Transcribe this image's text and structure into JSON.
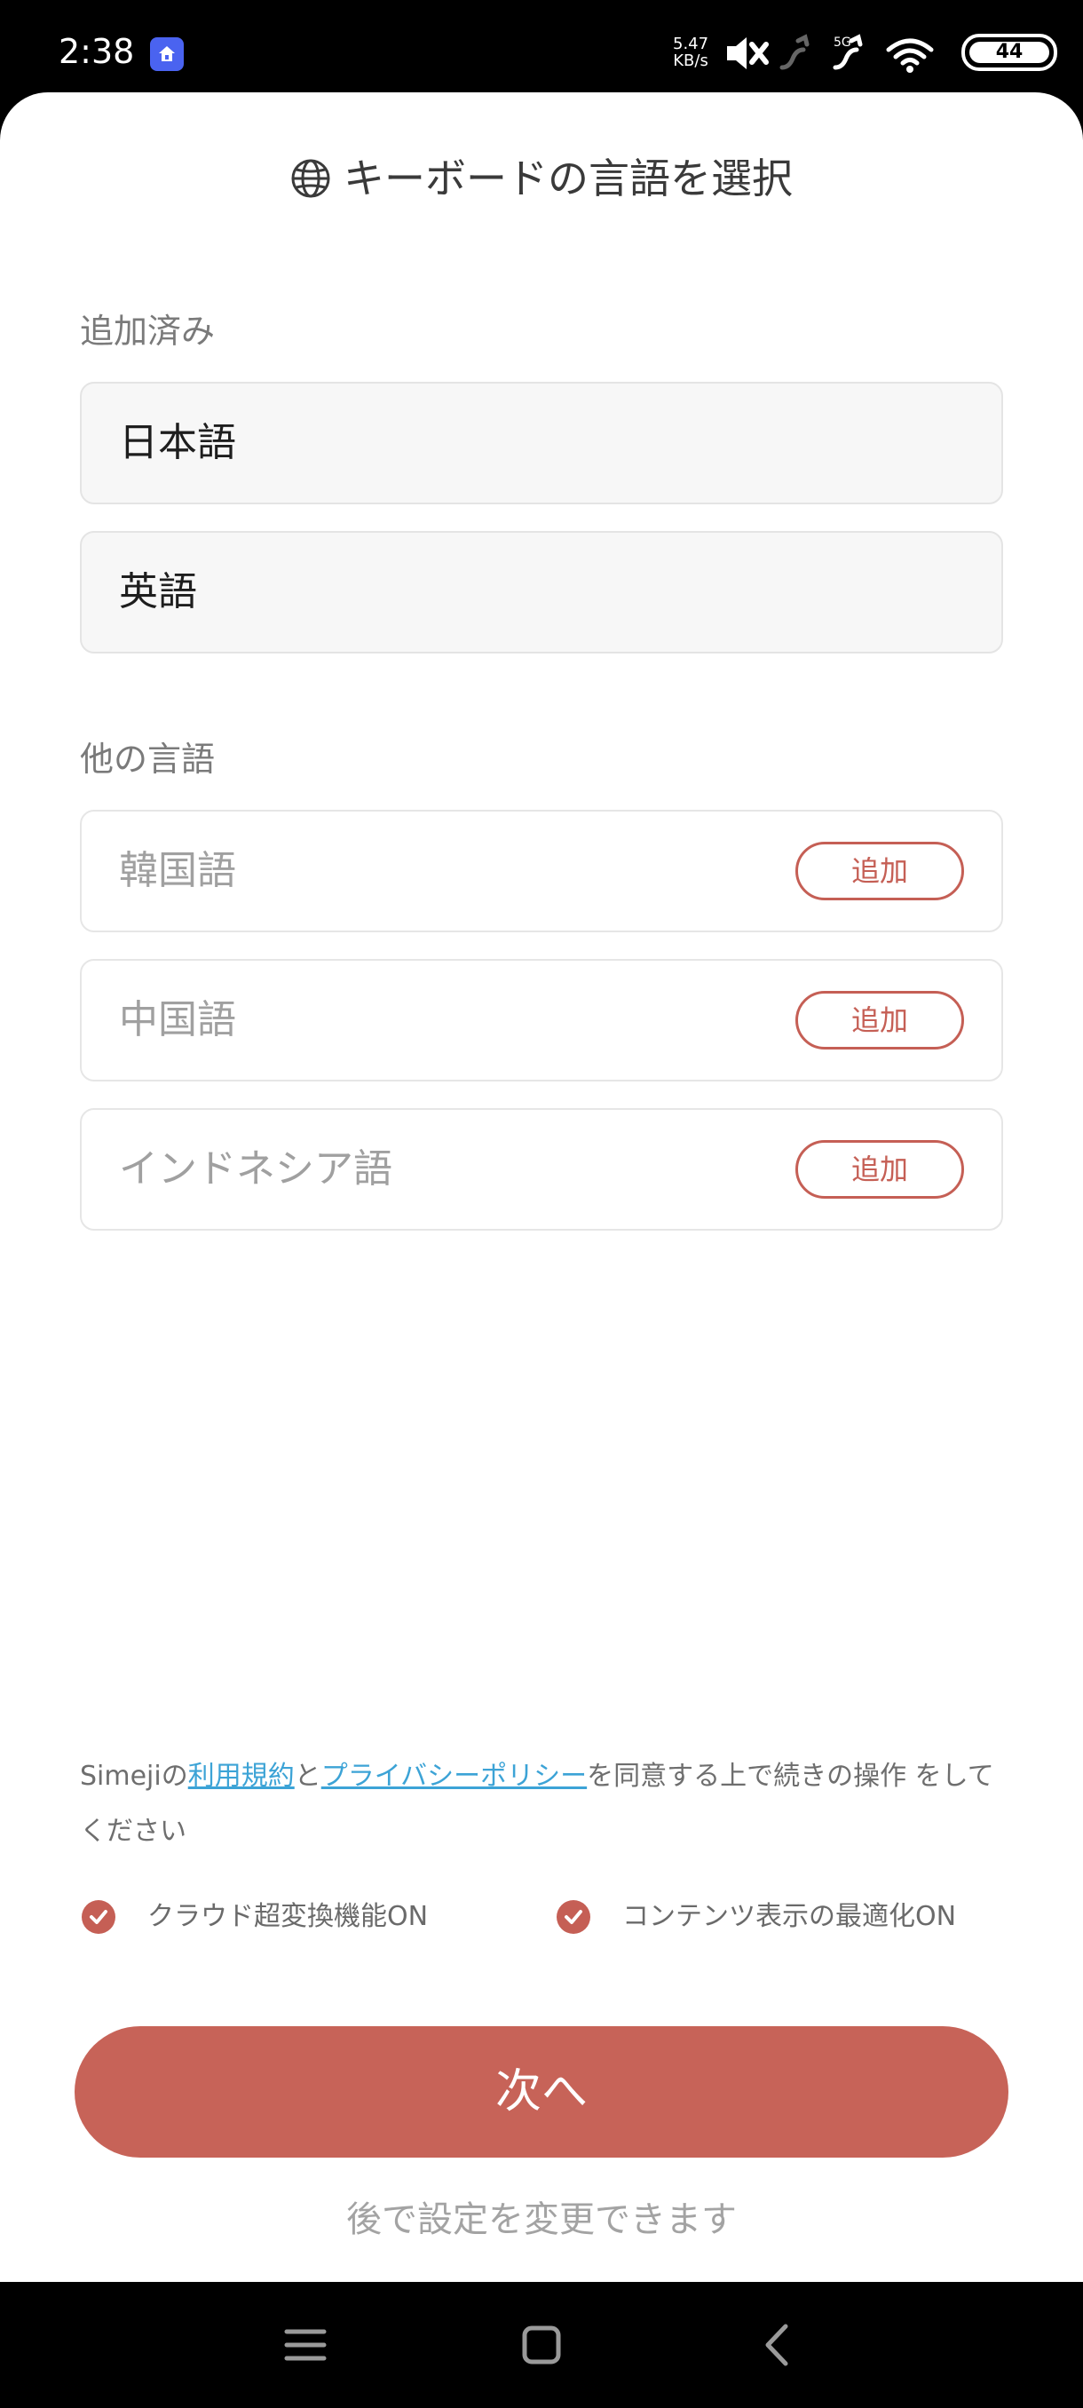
{
  "status_bar": {
    "time": "2:38",
    "app_badge_icon": "home-icon",
    "net_speed_value": "5.47",
    "net_speed_unit": "KB/s",
    "signal_label": "5G",
    "battery": "44"
  },
  "header": {
    "icon": "globe-icon",
    "title": "キーボードの言語を選択"
  },
  "added_section": {
    "label": "追加済み",
    "items": [
      {
        "name": "日本語"
      },
      {
        "name": "英語"
      }
    ]
  },
  "other_section": {
    "label": "他の言語",
    "items": [
      {
        "name": "韓国語",
        "button": "追加"
      },
      {
        "name": "中国語",
        "button": "追加"
      },
      {
        "name": "インドネシア語",
        "button": "追加"
      }
    ]
  },
  "terms": {
    "prefix": "Simejiの",
    "terms_link": "利用規約",
    "and": "と",
    "privacy_link": "プライバシーポリシー",
    "suffix": "を同意する上で続きの操作 をしてください"
  },
  "options": [
    {
      "label": "クラウド超変換機能ON",
      "checked": true
    },
    {
      "label": "コンテンツ表示の最適化ON",
      "checked": true
    }
  ],
  "next_button": "次へ",
  "later_note": "後で設定を変更できます",
  "colors": {
    "accent": "#c76358",
    "link": "#3ca3d6"
  }
}
